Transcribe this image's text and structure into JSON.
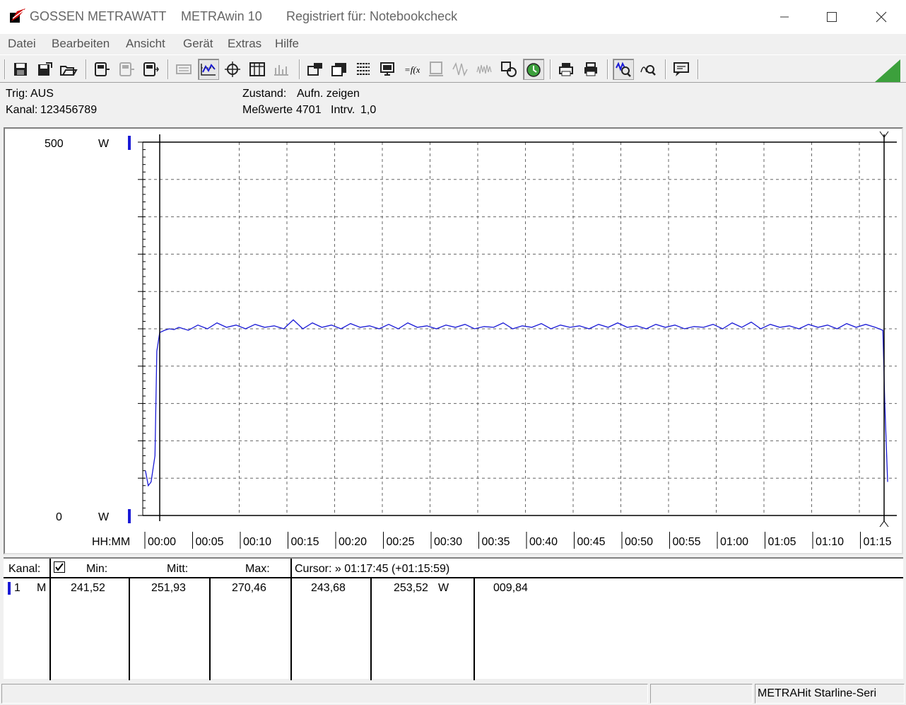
{
  "window": {
    "vendor": "GOSSEN METRAWATT",
    "app": "METRAwin 10",
    "registered": "Registriert für: Notebookcheck"
  },
  "menu": [
    "Datei",
    "Bearbeiten",
    "Ansicht",
    "Gerät",
    "Extras",
    "Hilfe"
  ],
  "toolbar_icons": [
    "save-icon",
    "save-as-icon",
    "open-icon",
    "device-in-icon",
    "device-disabled-icon",
    "device-out-icon",
    "keyboard-icon",
    "waveform-grid-icon",
    "crosshair-icon",
    "table-icon",
    "bar-table-icon",
    "monitor-settings-icon",
    "multi-window-icon",
    "list-settings-icon",
    "computer-icon",
    "function-icon",
    "device-display-icon",
    "signal-icon",
    "noise-icon",
    "copy-device-icon",
    "record-icon",
    "printer-icon",
    "print-preview-icon",
    "zoom-wave-icon",
    "zoom-icon",
    "message-icon"
  ],
  "info": {
    "trig_label": "Trig:",
    "trig_value": "AUS",
    "kanal_label": "Kanal:",
    "kanal_value": "123456789",
    "zustand_label": "Zustand:",
    "zustand_value": "Aufn. zeigen",
    "messwerte_label": "Meßwerte",
    "messwerte_value": "4701",
    "intrv_label": "Intrv.",
    "intrv_value": "1,0"
  },
  "chart_data": {
    "type": "line",
    "y_unit": "W",
    "y_top_label": "500",
    "y_bottom_label": "0",
    "ylim": [
      0,
      500
    ],
    "x_axis_label": "HH:MM",
    "x_ticks": [
      "00:00",
      "00:05",
      "00:10",
      "00:15",
      "00:20",
      "00:25",
      "00:30",
      "00:35",
      "00:40",
      "00:45",
      "00:50",
      "00:55",
      "01:00",
      "01:05",
      "01:10",
      "01:15"
    ],
    "grid": true,
    "series_color": "#1a1ad6",
    "series": [
      {
        "values_minutes": [
          -1.5,
          -1.2,
          -0.9,
          -0.5,
          -0.3,
          0,
          0.5,
          1,
          1.5,
          2,
          3,
          4,
          5,
          6,
          7,
          8,
          9,
          10,
          11,
          12,
          13,
          14,
          15,
          16,
          17,
          18,
          19,
          20,
          21,
          22,
          23,
          24,
          25,
          26,
          27,
          28,
          29,
          30,
          31,
          32,
          33,
          34,
          35,
          36,
          37,
          38,
          39,
          40,
          41,
          42,
          43,
          44,
          45,
          46,
          47,
          48,
          49,
          50,
          51,
          52,
          53,
          54,
          55,
          56,
          57,
          58,
          59,
          60,
          61,
          62,
          63,
          64,
          65,
          66,
          67,
          68,
          69,
          70,
          71,
          72,
          73,
          74,
          75,
          75.8,
          76,
          76.3
        ],
        "values_watt": [
          60,
          40,
          45,
          80,
          220,
          245,
          248,
          250,
          249,
          252,
          248,
          255,
          250,
          258,
          252,
          255,
          250,
          256,
          252,
          254,
          250,
          262,
          250,
          258,
          252,
          255,
          250,
          257,
          252,
          254,
          250,
          256,
          250,
          258,
          252,
          254,
          250,
          255,
          252,
          256,
          250,
          253,
          252,
          258,
          250,
          254,
          252,
          257,
          250,
          255,
          252,
          254,
          250,
          256,
          252,
          258,
          252,
          254,
          250,
          256,
          252,
          255,
          250,
          253,
          252,
          256,
          250,
          258,
          252,
          259,
          250,
          256,
          252,
          254,
          250,
          256,
          252,
          255,
          250,
          257,
          252,
          256,
          252,
          248,
          150,
          45
        ]
      }
    ]
  },
  "table": {
    "headers": {
      "kanal": "Kanal:",
      "min": "Min:",
      "mitt": "Mitt:",
      "max": "Max:",
      "cursor": "Cursor: » 01:17:45 (+01:15:59)"
    },
    "row": {
      "channel": "1",
      "mode": "M",
      "min": "241,52",
      "mitt": "251,93",
      "max": "270,46",
      "c1": "243,68",
      "c2": "253,52",
      "unit": "W",
      "c3": "009,84"
    }
  },
  "status": {
    "device": "METRAHit Starline-Seri"
  }
}
